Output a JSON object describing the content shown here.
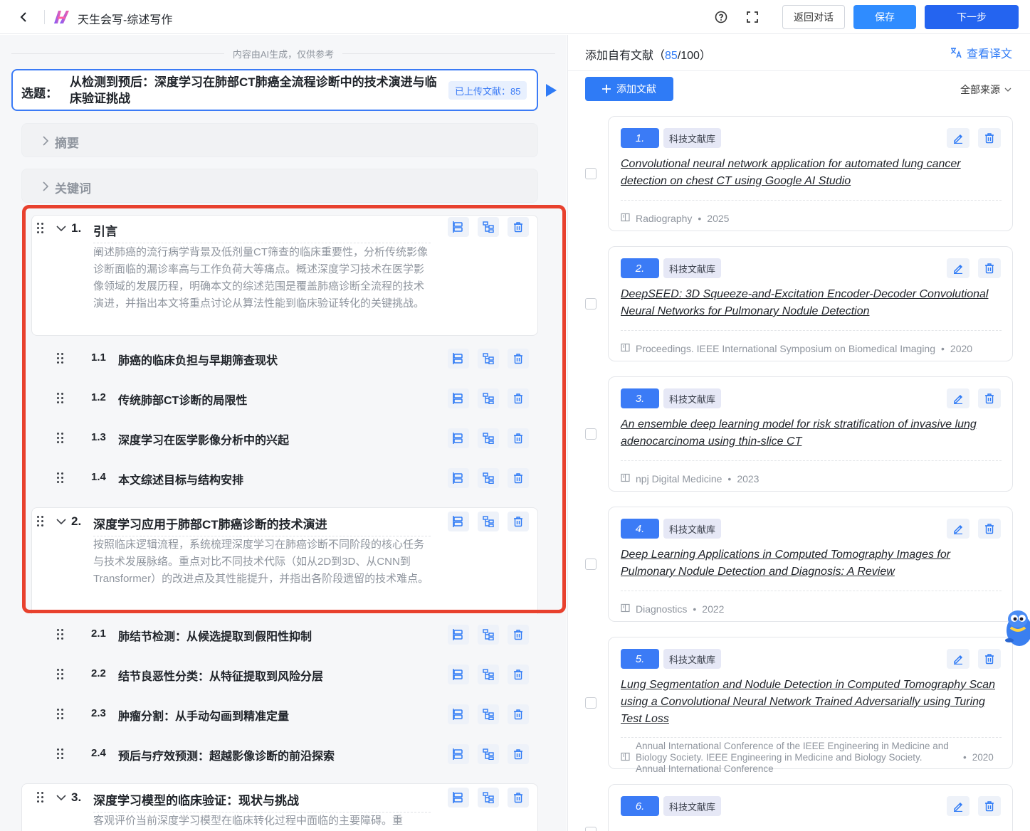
{
  "app": {
    "title": "天生会写-综述写作",
    "back_label": "返回对话",
    "save_label": "保存",
    "next_label": "下一步"
  },
  "colors": {
    "accent": "#2f7bf6",
    "next": "#2464f0",
    "highlight": "#e8412e"
  },
  "left": {
    "ai_note": "内容由AI生成，仅供参考",
    "topic": {
      "label": "选题：",
      "text": "从检测到预后：深度学习在肺部CT肺癌全流程诊断中的技术演进与临床验证挑战",
      "uploaded_badge": "已上传文献：85"
    },
    "abstract_label": "摘要",
    "keywords_label": "关键词",
    "sections": [
      {
        "num": "1.",
        "title": "引言",
        "desc": "阐述肺癌的流行病学背景及低剂量CT筛查的临床重要性，分析传统影像诊断面临的漏诊率高与工作负荷大等痛点。概述深度学习技术在医学影像领域的发展历程，明确本文的综述范围是覆盖肺癌诊断全流程的技术演进，并指出本文将重点讨论从算法性能到临床验证转化的关键挑战。",
        "subs": [
          {
            "num": "1.1",
            "title": "肺癌的临床负担与早期筛查现状"
          },
          {
            "num": "1.2",
            "title": "传统肺部CT诊断的局限性"
          },
          {
            "num": "1.3",
            "title": "深度学习在医学影像分析中的兴起"
          },
          {
            "num": "1.4",
            "title": "本文综述目标与结构安排"
          }
        ]
      },
      {
        "num": "2.",
        "title": "深度学习应用于肺部CT肺癌诊断的技术演进",
        "desc": "按照临床逻辑流程，系统梳理深度学习在肺癌诊断不同阶段的核心任务与技术发展脉络。重点对比不同技术代际（如从2D到3D、从CNN到Transformer）的改进点及其性能提升，并指出各阶段遗留的技术难点。",
        "subs": [
          {
            "num": "2.1",
            "title": "肺结节检测：从候选提取到假阳性抑制"
          },
          {
            "num": "2.2",
            "title": "结节良恶性分类：从特征提取到风险分层"
          },
          {
            "num": "2.3",
            "title": "肿瘤分割：从手动勾画到精准定量"
          },
          {
            "num": "2.4",
            "title": "预后与疗效预测：超越影像诊断的前沿探索"
          }
        ]
      },
      {
        "num": "3.",
        "title": "深度学习模型的临床验证：现状与挑战",
        "desc": "客观评价当前深度学习模型在临床转化过程中面临的主要障碍。重",
        "subs": []
      }
    ]
  },
  "right": {
    "title_prefix": "添加自有文献（",
    "count": "85",
    "title_suffix": "/100）",
    "translate_label": "查看译文",
    "add_label": "添加文献",
    "source_filter": "全部来源",
    "refs": [
      {
        "num": "1.",
        "tag": "科技文献库",
        "title": "Convolutional neural network application for automated lung cancer detection on chest CT using Google AI Studio",
        "journal": "Radiography",
        "year": "2025"
      },
      {
        "num": "2.",
        "tag": "科技文献库",
        "title": "DeepSEED: 3D Squeeze-and-Excitation Encoder-Decoder Convolutional Neural Networks for Pulmonary Nodule Detection",
        "journal": "Proceedings. IEEE International Symposium on Biomedical Imaging",
        "year": "2020"
      },
      {
        "num": "3.",
        "tag": "科技文献库",
        "title": "An ensemble deep learning model for risk stratification of invasive lung adenocarcinoma using thin-slice CT",
        "journal": "npj Digital Medicine",
        "year": "2023"
      },
      {
        "num": "4.",
        "tag": "科技文献库",
        "title": "Deep Learning Applications in Computed Tomography Images for Pulmonary Nodule Detection and Diagnosis: A Review",
        "journal": "Diagnostics",
        "year": "2022"
      },
      {
        "num": "5.",
        "tag": "科技文献库",
        "title": "Lung Segmentation and Nodule Detection in Computed Tomography Scan using a Convolutional Neural Network Trained Adversarially using Turing Test Loss",
        "journal": "Annual International Conference of the IEEE Engineering in Medicine and Biology Society. IEEE Engineering in Medicine and Biology Society. Annual International Conference",
        "year": "2020"
      },
      {
        "num": "6.",
        "tag": "科技文献库",
        "title": "",
        "journal": "",
        "year": ""
      }
    ]
  }
}
